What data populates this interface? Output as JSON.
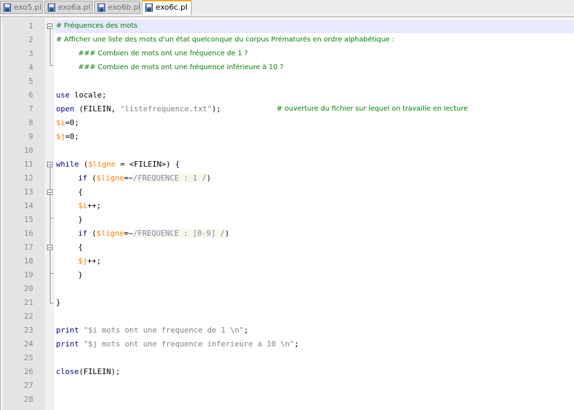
{
  "tabs": [
    {
      "label": "exo5.pl",
      "active": false
    },
    {
      "label": "exo6a.pl",
      "active": false
    },
    {
      "label": "exo6b.pl",
      "active": false
    },
    {
      "label": "exo6c.pl",
      "active": true
    }
  ],
  "line_numbers": [
    "1",
    "2",
    "3",
    "4",
    "5",
    "6",
    "7",
    "8",
    "9",
    "10",
    "11",
    "12",
    "13",
    "14",
    "15",
    "16",
    "17",
    "18",
    "19",
    "20",
    "21",
    "22",
    "23",
    "24",
    "25",
    "26",
    "27",
    "28"
  ],
  "code": {
    "l1": "# Fréquences des mots",
    "l2": "# Afficher une liste des mots d'un état quelconque du corpus Prématurés en ordre alphabétique :",
    "l3": "### Combien de mots ont une fréquence de 1 ?",
    "l4": "### Combien de mots ont une fréquence inférieure à 10 ?",
    "l6_kw": "use",
    "l6_rest": " locale;",
    "l7_kw": "open",
    "l7_a": " (FILEIN, ",
    "l7_str": "\"listefrequence.txt\"",
    "l7_b": ");",
    "l7_cmt": "# ouverture du fichier sur lequel on travaille en lecture",
    "l8_var": "$i",
    "l8_rest": "=0;",
    "l9_var": "$j",
    "l9_rest": "=0;",
    "l11_kw": "while",
    "l11_a": " (",
    "l11_var": "$ligne",
    "l11_b": " = <FILEIN>) {",
    "l12_kw": "if",
    "l12_a": " (",
    "l12_var": "$ligne",
    "l12_op": "=~",
    "l12_rx": "/FREQUENCE : 1 /",
    "l12_b": ")",
    "l13": "{",
    "l14_var": "$i",
    "l14_rest": "++;",
    "l15": "}",
    "l16_kw": "if",
    "l16_a": " (",
    "l16_var": "$ligne",
    "l16_op": "=~",
    "l16_rx": "/FREQUENCE : [0-9] /",
    "l16_b": ")",
    "l17": "{",
    "l18_var": "$j",
    "l18_rest": "++;",
    "l19": "}",
    "l21": "}",
    "l23_kw": "print",
    "l23_str": " \"$i mots ont une frequence de 1 \\n\"",
    "l23_b": ";",
    "l24_kw": "print",
    "l24_str": " \"$j mots ont une frequence inferieure a 10 \\n\"",
    "l24_b": ";",
    "l26_kw": "close",
    "l26_rest": "(FILEIN);"
  },
  "colors": {
    "keyword": "#00008b",
    "variable": "#ff8000",
    "string": "#808080",
    "comment": "#008000",
    "regex": "#8080c0",
    "current_line": "#e8e8ff",
    "active_tab_accent": "#f5a623"
  },
  "icons": [
    "document-save-icon",
    "fold-toggle-icon"
  ]
}
